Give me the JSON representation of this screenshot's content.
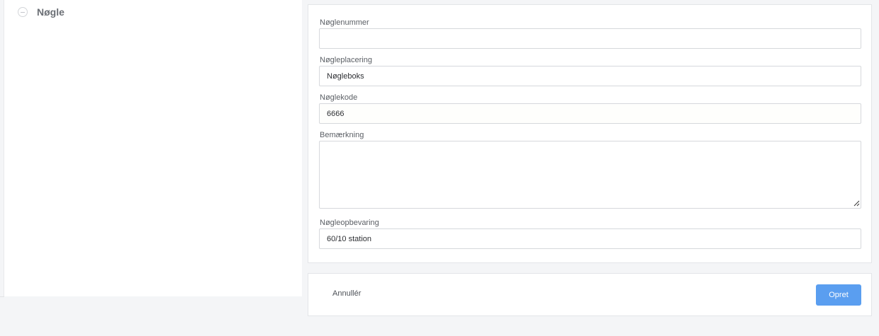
{
  "section": {
    "title": "Nøgle"
  },
  "fields": {
    "key_number": {
      "label": "Nøglenummer",
      "value": ""
    },
    "key_location": {
      "label": "Nøgleplacering",
      "value": "Nøgleboks"
    },
    "key_code": {
      "label": "Nøglekode",
      "value": "6666"
    },
    "remark": {
      "label": "Bemærkning",
      "value": ""
    },
    "key_storage": {
      "label": "Nøgleopbevaring",
      "value": "60/10 station"
    }
  },
  "actions": {
    "cancel_label": "Annullér",
    "create_label": "Opret"
  },
  "colors": {
    "primary": "#5a9ef0",
    "background": "#f4f5f7"
  },
  "icons": {
    "collapse": "minus-circle-icon",
    "resize": "resize-handle-icon"
  }
}
